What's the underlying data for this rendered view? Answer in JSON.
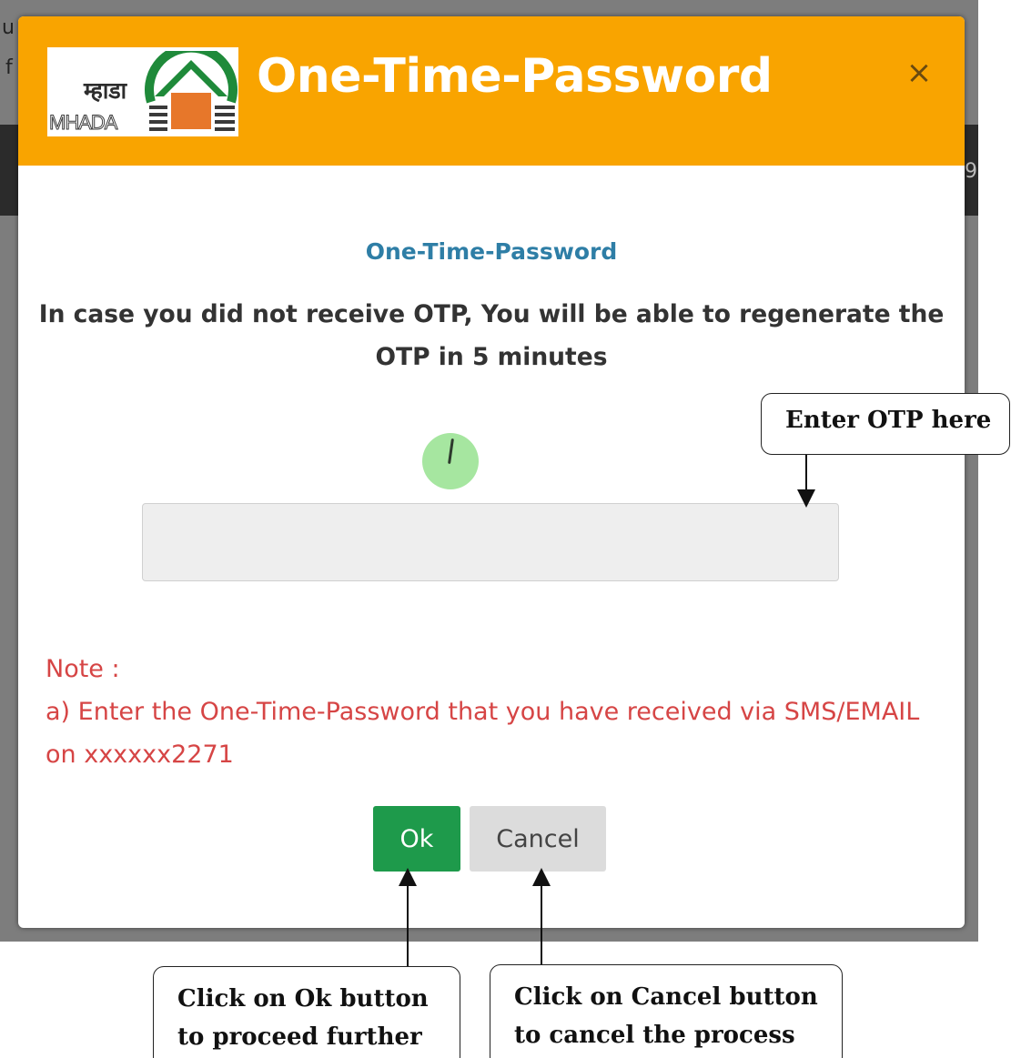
{
  "background": {
    "fragment_top": "u",
    "fragment_left": "f",
    "fragment_right": "9"
  },
  "modal": {
    "logo": {
      "hindi_text": "म्हाडा",
      "english_text": "MHADA"
    },
    "title": "One-Time-Password",
    "close_label": "×",
    "subtitle": "One-Time-Password",
    "info_text": "In case you did not receive OTP, You will be able to regenerate the OTP in 5 minutes",
    "otp_input": {
      "value": "",
      "placeholder": ""
    },
    "note": {
      "heading": "Note :",
      "line": "a) Enter the One-Time-Password that you have received via SMS/EMAIL on xxxxxx2271"
    },
    "buttons": {
      "ok_label": "Ok",
      "cancel_label": "Cancel"
    }
  },
  "annotations": {
    "otp_callout": "Enter OTP here",
    "ok_callout_line1": "Click on Ok button",
    "ok_callout_line2": "to proceed further",
    "cancel_callout_line1": "Click on Cancel button",
    "cancel_callout_line2": "to cancel the process"
  },
  "colors": {
    "header": "#f9a400",
    "subtitle": "#2e7ea6",
    "note": "#d64545",
    "ok_button": "#1e9a4b",
    "cancel_button": "#dcdcdc",
    "spinner": "#a6e6a0"
  }
}
